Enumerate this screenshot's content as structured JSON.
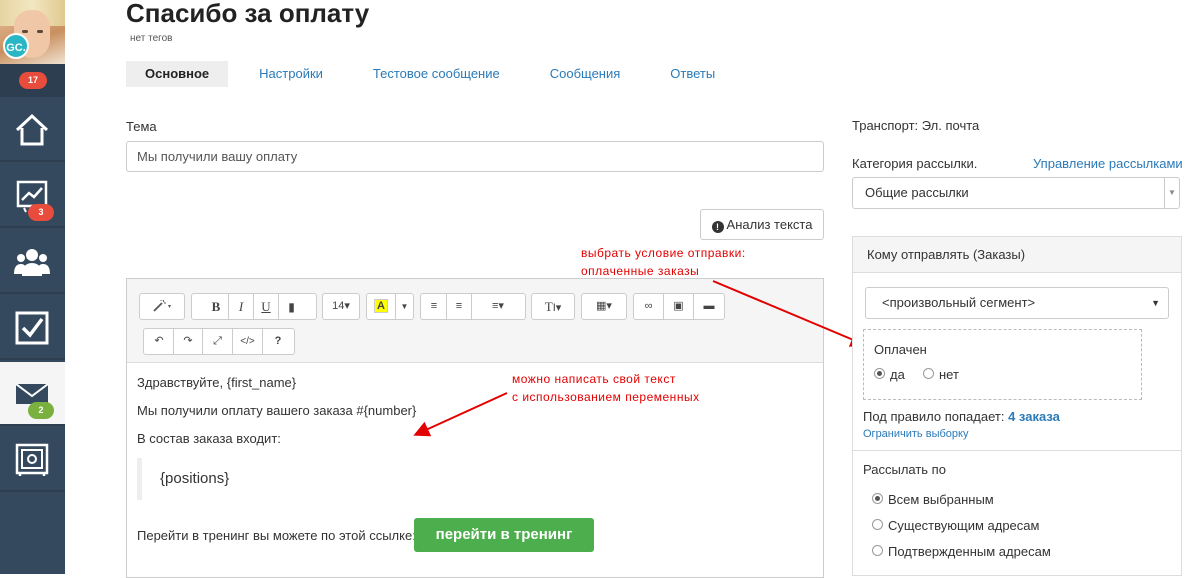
{
  "sidebar": {
    "avatar_initials": "GC.",
    "notification_count": "17",
    "items": [
      {
        "icon": "home-icon",
        "badge": ""
      },
      {
        "icon": "chart-icon",
        "badge": "3"
      },
      {
        "icon": "users-icon",
        "badge": ""
      },
      {
        "icon": "checkbox-icon",
        "badge": ""
      },
      {
        "icon": "mail-icon",
        "badge": "2"
      },
      {
        "icon": "safe-icon",
        "badge": ""
      }
    ]
  },
  "header": {
    "title": "Спасибо за оплату",
    "tags": "нет тегов",
    "tabs": [
      "Основное",
      "Настройки",
      "Тестовое сообщение",
      "Сообщения",
      "Ответы"
    ]
  },
  "form": {
    "subject_label": "Тема",
    "subject_value": "Мы получили вашу оплату",
    "analysis_button": "Анализ текста",
    "toolbar": {
      "font_size": "14"
    }
  },
  "editor": {
    "greeting": "Здравствуйте, {first_name}",
    "line1": "Мы получили оплату вашего заказа #{number}",
    "line2": "В состав заказа входит:",
    "positions": "{positions}",
    "link_text": "Перейти в тренинг вы можете по этой ссылке:",
    "button": "перейти в тренинг"
  },
  "annotations": {
    "a1_line1": "выбрать условие отправки:",
    "a1_line2": "оплаченные заказы",
    "a2_line1": "можно написать свой текст",
    "a2_line2": "с использованием переменных"
  },
  "right": {
    "transport": "Транспорт: Эл. почта",
    "category_label": "Категория рассылки.",
    "manage_link": "Управление рассылками",
    "category_value": "Общие рассылки",
    "panel_title": "Кому отправлять (Заказы)",
    "segment_value": "<произвольный сегмент>",
    "paid_label": "Оплачен",
    "yes": "да",
    "no": "нет",
    "rule_prefix": "Под правило попадает:",
    "rule_count": "4 заказа",
    "limit_link": "Ограничить выборку",
    "send_by": "Рассылать по",
    "send_options": [
      "Всем выбранным",
      "Существующим адресам",
      "Подтвержденным адресам"
    ]
  },
  "colors": {
    "accent": "#2a7ab8",
    "sidebar": "#34495e",
    "annotation": "#e30000",
    "cta": "#4cae4c"
  }
}
